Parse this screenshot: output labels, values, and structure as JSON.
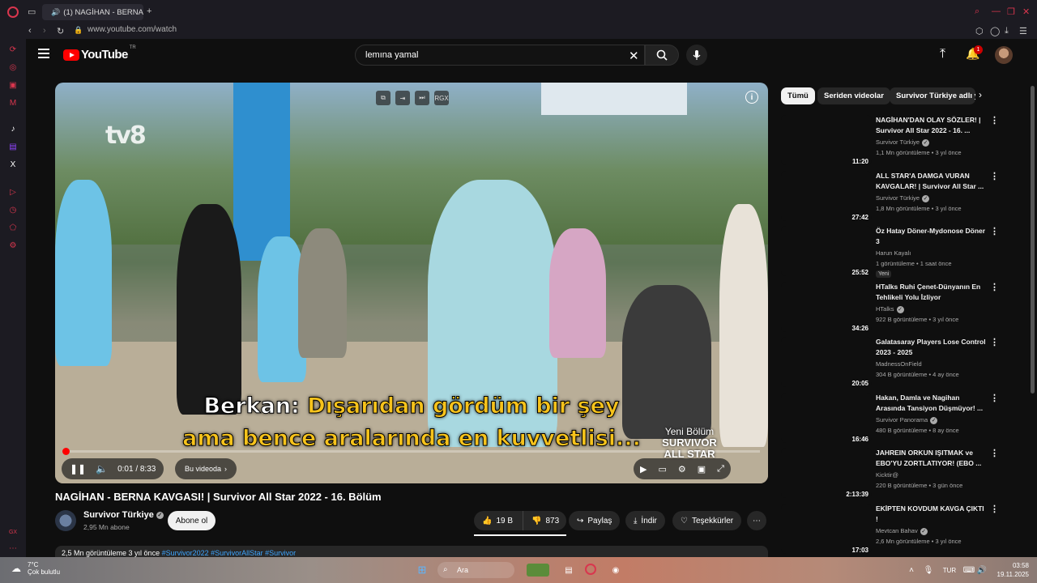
{
  "browser": {
    "tab_title": "(1) NAGİHAN - BERNA",
    "url": "www.youtube.com/watch"
  },
  "masthead": {
    "logo_text": "YouTube",
    "logo_region": "TR",
    "search_value": "lemına yamal",
    "notification_count": "1"
  },
  "player": {
    "watermark": "tv8",
    "overlay_badge": "RGX",
    "subtitle_line1_speaker": "Berkan:",
    "subtitle_line1_text": "Dışarıdan gördüm bir şey",
    "subtitle_line2_text": "ama bence aralarında en kuvvetlisi...",
    "new_episode_label": "Yeni Bölüm",
    "new_episode_show_1": "SURVIVOR",
    "new_episode_show_2": "ALL STAR",
    "time_current": "0:01",
    "time_separator": "/",
    "time_total": "8:33",
    "chapter_label": "Bu videoda",
    "progress_fraction": 0.002
  },
  "video": {
    "title": "NAGİHAN - BERNA KAVGASI! | Survivor All Star 2022 - 16. Bölüm",
    "channel_name": "Survivor Türkiye",
    "subscribers": "2,95 Mn abone",
    "subscribe_label": "Abone ol",
    "likes": "19 B",
    "dislikes": "873",
    "share_label": "Paylaş",
    "download_label": "İndir",
    "thanks_label": "Teşekkürler",
    "description_stats": "2,5 Mn görüntüleme  3 yıl önce",
    "description_tags": "#Survivor2022 #SurvivorAllStar #Survivor"
  },
  "sidebar": {
    "chips": [
      "Tümü",
      "Seriden videolar",
      "Survivor Türkiye adlı y"
    ],
    "recommendations": [
      {
        "title": "NAGİHAN'DAN OLAY SÖZLER! | Survivor All Star 2022 - 16. ...",
        "channel": "Survivor Türkiye",
        "verified": true,
        "meta": "1,1 Mn görüntüleme • 3 yıl önce",
        "duration": "11:20",
        "badge": ""
      },
      {
        "title": "ALL STAR'A DAMGA VURAN KAVGALAR! | Survivor All Star ...",
        "channel": "Survivor Türkiye",
        "verified": true,
        "meta": "1,8 Mn görüntüleme • 3 yıl önce",
        "duration": "27:42",
        "badge": ""
      },
      {
        "title": "Öz Hatay Döner-Mydonose Döner 3",
        "channel": "Harun Kayalı",
        "verified": false,
        "meta": "1 görüntüleme • 1 saat önce",
        "duration": "25:52",
        "badge": "Yeni"
      },
      {
        "title": "HTalks Ruhi Çenet-Dünyanın En Tehlikeli Yolu İzliyor",
        "channel": "HTalks",
        "verified": true,
        "meta": "922 B görüntüleme • 3 yıl önce",
        "duration": "34:26",
        "badge": ""
      },
      {
        "title": "Galatasaray Players Lose Control 2023 - 2025",
        "channel": "MadnessOnField",
        "verified": false,
        "meta": "304 B görüntüleme • 4 ay önce",
        "duration": "20:05",
        "badge": ""
      },
      {
        "title": "Hakan, Damla ve Nagihan Arasında Tansiyon Düşmüyor! ...",
        "channel": "Survivor Panorama",
        "verified": true,
        "meta": "480 B görüntüleme • 8 ay önce",
        "duration": "16:46",
        "badge": ""
      },
      {
        "title": "JAHREIN ORKUN IŞITMAK ve EBO'YU ZORTLATIYOR! (EBO ...",
        "channel": "Kicktir@",
        "verified": false,
        "meta": "220 B görüntüleme • 3 gün önce",
        "duration": "2:13:39",
        "badge": ""
      },
      {
        "title": "EKİPTEN KOVDUM KAVGA ÇIKTI !",
        "channel": "Mevtcan Bahav",
        "verified": true,
        "meta": "2,6 Mn görüntüleme • 3 yıl önce",
        "duration": "17:03",
        "badge": ""
      }
    ]
  },
  "taskbar": {
    "temperature": "7°C",
    "weather": "Çok bulutlu",
    "search_placeholder": "Ara",
    "language": "TUR",
    "time": "03:58",
    "date": "19.11.2025"
  },
  "colors": {
    "accent": "#ff0000",
    "subtitle_yellow": "#f7c31b",
    "link_blue": "#3ea6ff",
    "opera_red": "#d9364e"
  }
}
